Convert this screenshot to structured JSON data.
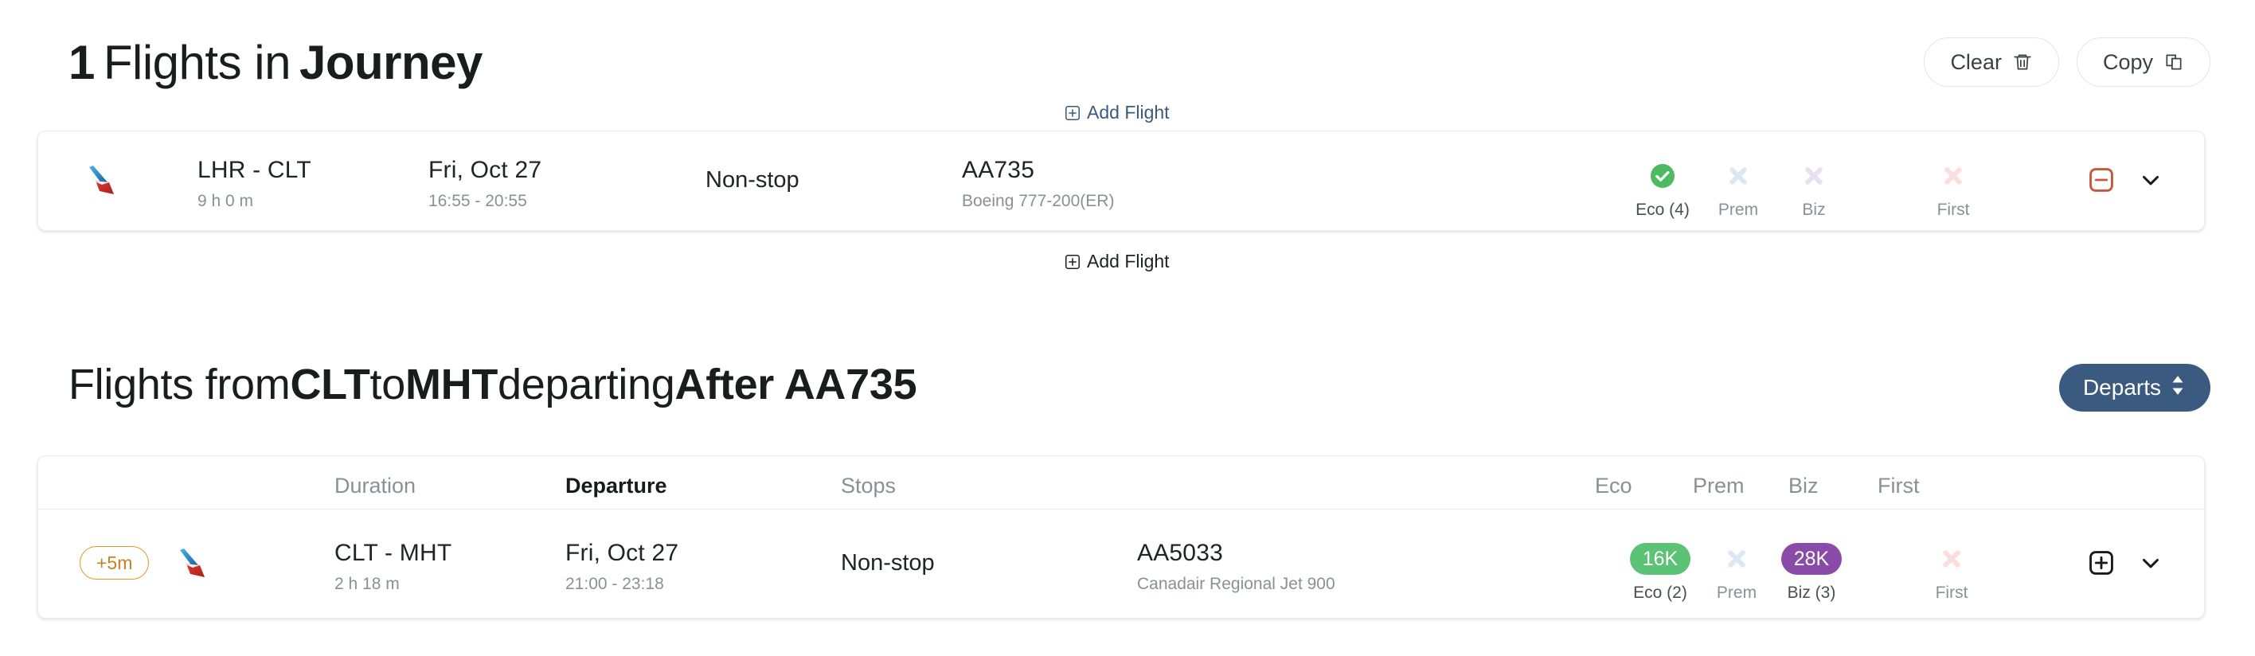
{
  "journey": {
    "title_count": "1",
    "title_mid": "Flights in",
    "title_strong": "Journey",
    "clear_label": "Clear",
    "copy_label": "Copy",
    "add_flight_top": "Add Flight",
    "add_flight_bottom": "Add Flight",
    "flight": {
      "route": "LHR - CLT",
      "duration": "9 h 0 m",
      "date": "Fri, Oct 27",
      "times": "16:55 - 20:55",
      "stops": "Non-stop",
      "flight_no": "AA735",
      "aircraft": "Boeing 777-200(ER)",
      "cabins": [
        {
          "label": "Eco (4)",
          "state": "available",
          "badge": null,
          "label_on": true
        },
        {
          "label": "Prem",
          "state": "unavailable",
          "badge": null,
          "label_on": false
        },
        {
          "label": "Biz",
          "state": "unavailable",
          "badge": null,
          "label_on": false
        },
        {
          "label": "First",
          "state": "unavailable",
          "badge": null,
          "label_on": false
        }
      ]
    }
  },
  "results": {
    "title_prefix": "Flights from",
    "title_origin": "CLT",
    "title_to": "to",
    "title_dest": "MHT",
    "title_departing": "departing",
    "title_after": "After AA735",
    "sort_label": "Departs",
    "columns": [
      {
        "key": "duration",
        "label": "Duration",
        "active": false
      },
      {
        "key": "departure",
        "label": "Departure",
        "active": true
      },
      {
        "key": "stops",
        "label": "Stops",
        "active": false
      },
      {
        "key": "eco",
        "label": "Eco",
        "active": false
      },
      {
        "key": "prem",
        "label": "Prem",
        "active": false
      },
      {
        "key": "biz",
        "label": "Biz",
        "active": false
      },
      {
        "key": "first",
        "label": "First",
        "active": false
      }
    ],
    "rows": [
      {
        "delay_badge": "+5m",
        "route": "CLT - MHT",
        "duration": "2 h 18 m",
        "date": "Fri, Oct 27",
        "times": "21:00 - 23:18",
        "stops": "Non-stop",
        "flight_no": "AA5033",
        "aircraft": "Canadair Regional Jet 900",
        "cabins": [
          {
            "label": "Eco (2)",
            "state": "price",
            "badge": "16K",
            "badge_color": "#5cc275",
            "label_on": true
          },
          {
            "label": "Prem",
            "state": "unavailable",
            "badge": null,
            "label_on": false
          },
          {
            "label": "Biz (3)",
            "state": "price",
            "badge": "28K",
            "badge_color": "#8a4ba8",
            "label_on": true
          },
          {
            "label": "First",
            "state": "unavailable",
            "badge": null,
            "label_on": false
          }
        ]
      }
    ]
  },
  "colors": {
    "accent_blue": "#3b5a80",
    "link_blue": "#3c5a7d",
    "eco_green": "#4cb963",
    "biz_purple": "#8a4ba8",
    "remove_red": "#c8553d",
    "delay_orange": "#c97f1e",
    "x_prem": "#dbe7f2",
    "x_biz": "#e8dff0",
    "x_first": "#fadedd"
  },
  "icons": {
    "clear": "trash-icon",
    "copy": "copy-icon",
    "add": "plus-square-icon",
    "remove": "minus-square-icon",
    "expand": "chevron-down-icon",
    "sort": "sort-updown-icon",
    "available": "check-circle-icon",
    "unavailable": "x-mark-icon",
    "airline": "american-airlines-logo"
  }
}
